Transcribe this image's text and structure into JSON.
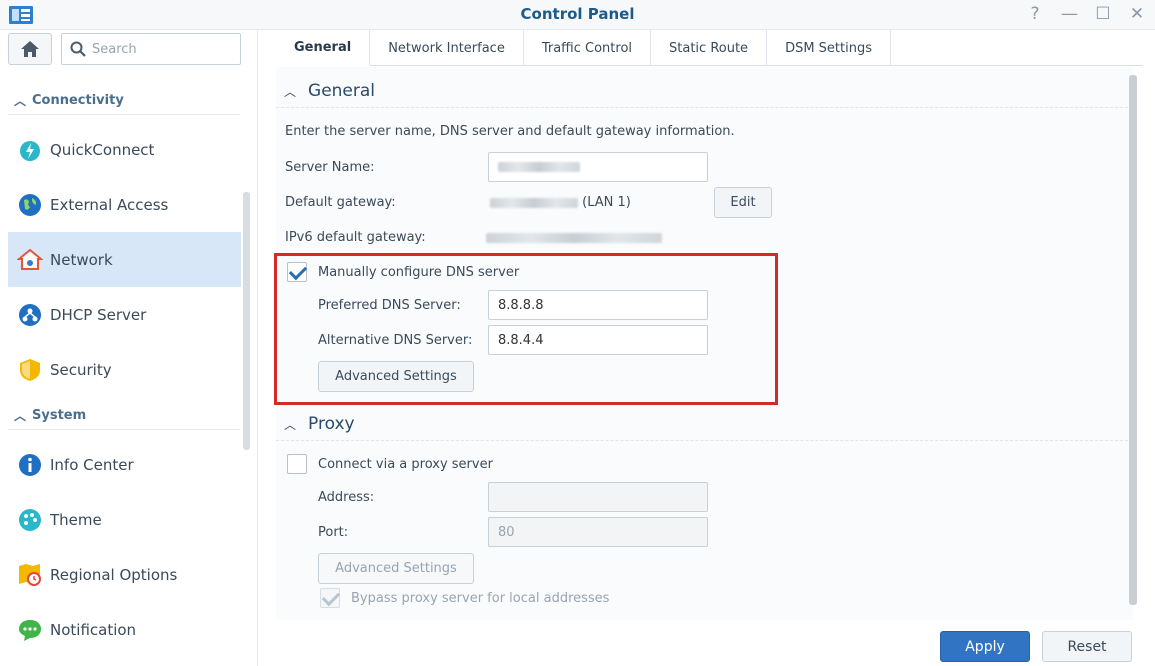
{
  "window": {
    "title": "Control Panel",
    "controls": [
      "?",
      "—",
      "☐",
      "✕"
    ]
  },
  "sidebar": {
    "search_placeholder": "Search",
    "sections": {
      "connectivity": "Connectivity",
      "system": "System"
    },
    "items": [
      {
        "label": "QuickConnect",
        "icon": "quickconnect-icon"
      },
      {
        "label": "External Access",
        "icon": "globe-icon"
      },
      {
        "label": "Network",
        "icon": "house-network-icon",
        "active": true
      },
      {
        "label": "DHCP Server",
        "icon": "dhcp-icon"
      },
      {
        "label": "Security",
        "icon": "shield-icon"
      },
      {
        "label": "Info Center",
        "icon": "info-icon"
      },
      {
        "label": "Theme",
        "icon": "palette-icon"
      },
      {
        "label": "Regional Options",
        "icon": "map-clock-icon"
      },
      {
        "label": "Notification",
        "icon": "chat-bubble-icon"
      }
    ]
  },
  "tabs": [
    "General",
    "Network Interface",
    "Traffic Control",
    "Static Route",
    "DSM Settings"
  ],
  "general": {
    "title": "General",
    "description": "Enter the server name, DNS server and default gateway information.",
    "server_name_label": "Server Name:",
    "default_gateway_label": "Default gateway:",
    "default_gateway_suffix": "(LAN 1)",
    "edit_label": "Edit",
    "ipv6_gateway_label": "IPv6 default gateway:",
    "manual_dns_label": "Manually configure DNS server",
    "preferred_dns_label": "Preferred DNS Server:",
    "preferred_dns_value": "8.8.8.8",
    "alternative_dns_label": "Alternative DNS Server:",
    "alternative_dns_value": "8.8.4.4",
    "advanced_label": "Advanced Settings"
  },
  "proxy": {
    "title": "Proxy",
    "connect_label": "Connect via a proxy server",
    "address_label": "Address:",
    "address_value": "",
    "port_label": "Port:",
    "port_value": "80",
    "advanced_label": "Advanced Settings",
    "bypass_label": "Bypass proxy server for local addresses"
  },
  "footer": {
    "apply": "Apply",
    "reset": "Reset"
  },
  "colors": {
    "accent": "#3274c4",
    "highlight_box": "#d62a2a",
    "active_nav": "#d7e7f7"
  }
}
